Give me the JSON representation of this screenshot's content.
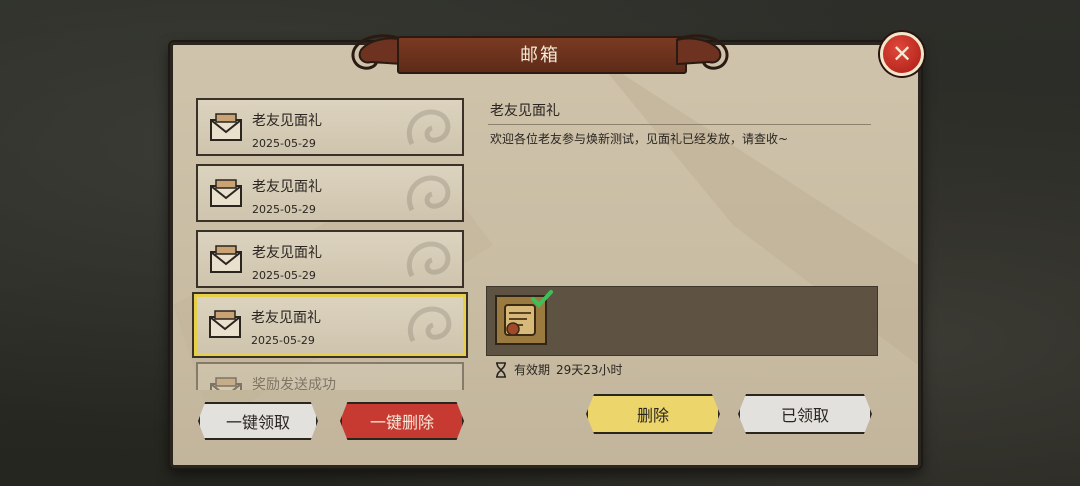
{
  "window_title": "邮箱",
  "mail_list": [
    {
      "title": "老友见面礼",
      "date": "2025-05-29"
    },
    {
      "title": "老友见面礼",
      "date": "2025-05-29"
    },
    {
      "title": "老友见面礼",
      "date": "2025-05-29"
    },
    {
      "title": "老友见面礼",
      "date": "2025-05-29"
    },
    {
      "title": "奖励发送成功",
      "date": ""
    }
  ],
  "buttons": {
    "claim_all": "一键领取",
    "delete_all": "一键删除",
    "delete": "删除",
    "claimed": "已领取"
  },
  "detail": {
    "title": "老友见面礼",
    "body": "欢迎各位老友参与焕新测试，见面礼已经发放，请查收~",
    "validity_label": "有效期",
    "validity_value": "29天23小时"
  },
  "icons": {
    "close": "close-icon",
    "mail": "envelope-icon",
    "reward": "scroll-icon",
    "check": "check-icon",
    "hourglass": "hourglass-icon"
  },
  "colors": {
    "panel": "#c8bca3",
    "delete_all_button": "#c73a32",
    "delete_button": "#ecd56a",
    "selected_border": "#e7cf4a",
    "check": "#3fbf5a"
  }
}
